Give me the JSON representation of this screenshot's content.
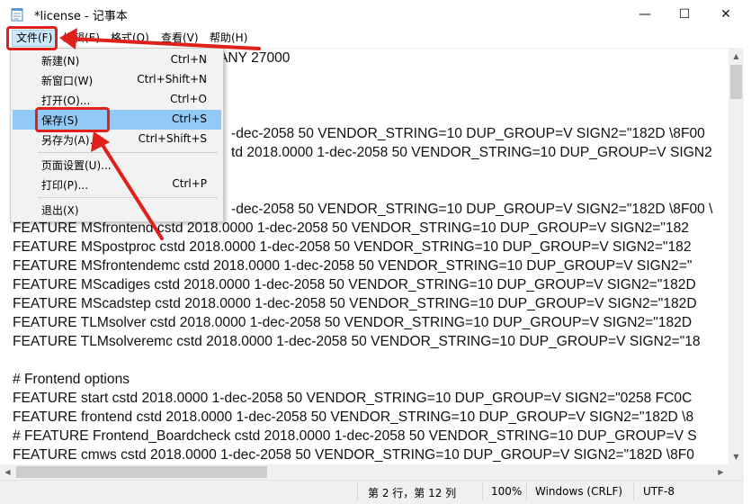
{
  "window": {
    "title": "*license - 记事本",
    "minimize_glyph": "—",
    "maximize_glyph": "☐",
    "close_glyph": "✕"
  },
  "menubar": {
    "file": "文件(F)",
    "edit": "编辑(E)",
    "format": "格式(O)",
    "view": "查看(V)",
    "help": "帮助(H)"
  },
  "file_menu": {
    "items": [
      {
        "label": "新建(N)",
        "shortcut": "Ctrl+N"
      },
      {
        "label": "新窗口(W)",
        "shortcut": "Ctrl+Shift+N"
      },
      {
        "label": "打开(O)...",
        "shortcut": "Ctrl+O"
      },
      {
        "label": "保存(S)",
        "shortcut": "Ctrl+S"
      },
      {
        "label": "另存为(A)...",
        "shortcut": "Ctrl+Shift+S"
      },
      {
        "label": "页面设置(U)...",
        "shortcut": ""
      },
      {
        "label": "打印(P)...",
        "shortcut": "Ctrl+P"
      },
      {
        "label": "退出(X)",
        "shortcut": ""
      }
    ]
  },
  "editor": {
    "lines": [
      "ANY 27000",
      "",
      "",
      "-dec-2058 50 VENDOR_STRING=10 DUP_GROUP=V SIGN2=\"182D \\8F00",
      "td 2018.0000 1-dec-2058 50 VENDOR_STRING=10 DUP_GROUP=V SIGN2",
      "",
      "",
      "-dec-2058 50 VENDOR_STRING=10 DUP_GROUP=V SIGN2=\"182D \\8F00 \\",
      "FEATURE MSfrontend cstd 2018.0000 1-dec-2058 50 VENDOR_STRING=10 DUP_GROUP=V SIGN2=\"182",
      "FEATURE MSpostproc cstd 2018.0000 1-dec-2058 50 VENDOR_STRING=10 DUP_GROUP=V SIGN2=\"182",
      "FEATURE MSfrontendemc cstd 2018.0000 1-dec-2058 50 VENDOR_STRING=10 DUP_GROUP=V SIGN2=\"",
      "FEATURE MScadiges cstd 2018.0000 1-dec-2058 50 VENDOR_STRING=10 DUP_GROUP=V SIGN2=\"182D",
      "FEATURE MScadstep cstd 2018.0000 1-dec-2058 50 VENDOR_STRING=10 DUP_GROUP=V SIGN2=\"182D",
      "FEATURE TLMsolver cstd 2018.0000 1-dec-2058 50 VENDOR_STRING=10 DUP_GROUP=V SIGN2=\"182D",
      "FEATURE TLMsolveremc cstd 2018.0000 1-dec-2058 50 VENDOR_STRING=10 DUP_GROUP=V SIGN2=\"18",
      "",
      "# Frontend options",
      "FEATURE start cstd 2018.0000 1-dec-2058 50 VENDOR_STRING=10 DUP_GROUP=V SIGN2=\"0258 FC0C",
      "FEATURE frontend cstd 2018.0000 1-dec-2058 50 VENDOR_STRING=10 DUP_GROUP=V SIGN2=\"182D \\8",
      "# FEATURE Frontend_Boardcheck cstd 2018.0000 1-dec-2058 50 VENDOR_STRING=10 DUP_GROUP=V S",
      "FEATURE cmws cstd 2018.0000 1-dec-2058 50 VENDOR_STRING=10 DUP_GROUP=V SIGN2=\"182D \\8F0"
    ]
  },
  "statusbar": {
    "position": "第 2 行，第 12 列",
    "zoom": "100%",
    "line_ending": "Windows (CRLF)",
    "encoding": "UTF-8"
  },
  "colors": {
    "highlight": "#91c9f7",
    "annotation_red": "#e0201a"
  }
}
